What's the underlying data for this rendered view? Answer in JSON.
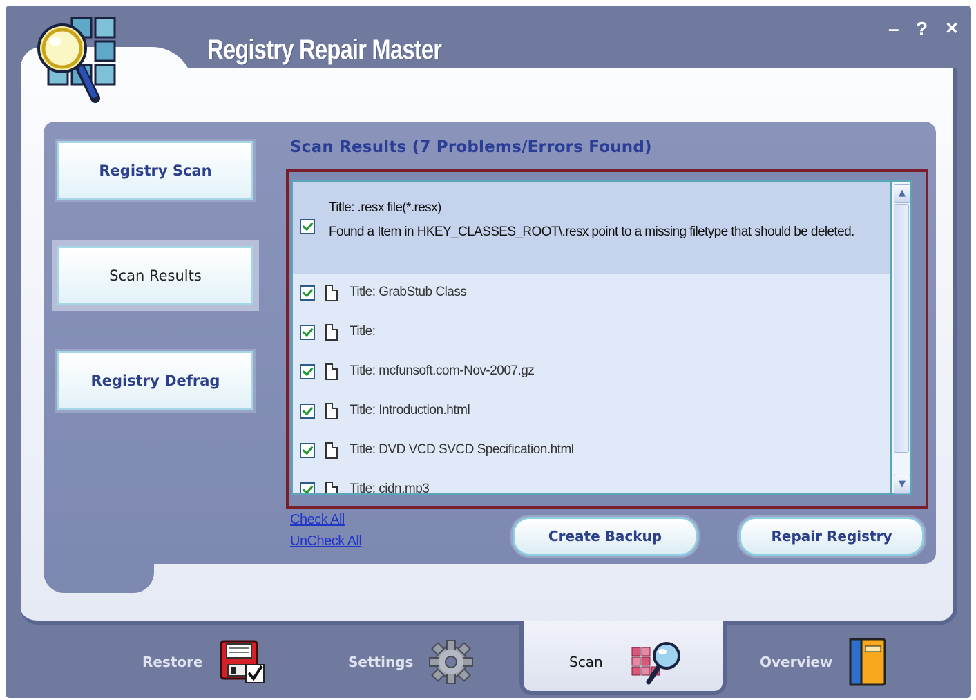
{
  "app": {
    "title": "Registry Repair Master",
    "window_controls": {
      "minimize": "–",
      "help": "?",
      "close": "✕"
    }
  },
  "sidebar": {
    "items": [
      {
        "label": "Registry Scan",
        "active": false
      },
      {
        "label": "Scan Results",
        "active": true
      },
      {
        "label": "Registry Defrag",
        "active": false
      }
    ]
  },
  "results": {
    "title": "Scan Results (7 Problems/Errors Found)",
    "first_item": {
      "title": "Title: .resx file(*.resx)",
      "detail": "Found a Item in HKEY_CLASSES_ROOT\\.resx point to a missing filetype that should be deleted."
    },
    "items": [
      {
        "label": "Title: GrabStub Class",
        "checked": true
      },
      {
        "label": "Title:",
        "checked": true
      },
      {
        "label": "Title: mcfunsoft.com-Nov-2007.gz",
        "checked": true
      },
      {
        "label": "Title: Introduction.html",
        "checked": true
      },
      {
        "label": "Title: DVD VCD SVCD Specification.html",
        "checked": true
      },
      {
        "label": "Title: cidn.mp3",
        "checked": true
      }
    ]
  },
  "links": {
    "check_all": "Check All",
    "uncheck_all": "UnCheck All"
  },
  "actions": {
    "create_backup": "Create Backup",
    "repair_registry": "Repair Registry"
  },
  "tabs": [
    {
      "label": "Restore",
      "icon": "floppy-disk-icon"
    },
    {
      "label": "Settings",
      "icon": "gear-icon"
    },
    {
      "label": "Scan",
      "icon": "scan-magnifier-icon",
      "active": true
    },
    {
      "label": "Overview",
      "icon": "book-icon"
    }
  ],
  "colors": {
    "frame": "#6f7a9e",
    "accent_text": "#2b3e96",
    "results_border": "#7a1e2c",
    "list_bg": "#dfe9f8"
  }
}
